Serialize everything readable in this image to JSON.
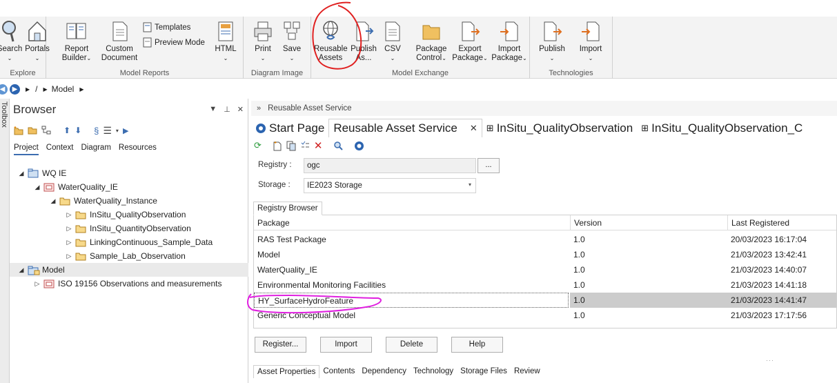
{
  "ribbon": {
    "buttons": {
      "search": "Search",
      "portals": "Portals",
      "report_builder": "Report Builder",
      "custom_document": "Custom Document",
      "templates": "Templates",
      "preview_mode": "Preview Mode",
      "html": "HTML",
      "print": "Print",
      "save": "Save",
      "reusable_assets": "Reusable Assets",
      "publish_as": "Publish As...",
      "csv": "CSV",
      "package_control": "Package Control",
      "export_package": "Export Package",
      "import_package": "Import Package",
      "publish": "Publish",
      "import": "Import"
    },
    "groups": {
      "explore": "Explore",
      "model_reports": "Model Reports",
      "diagram_image": "Diagram Image",
      "model_exchange": "Model Exchange",
      "technologies": "Technologies"
    }
  },
  "navbar": {
    "separator": "/",
    "crumb": "Model"
  },
  "browser": {
    "title": "Browser",
    "toolbox_label": "Toolbox",
    "tabs": [
      "Project",
      "Context",
      "Diagram",
      "Resources"
    ],
    "tree": [
      {
        "label": "WQ IE",
        "toggle": "◢"
      },
      {
        "label": "WaterQuality_IE",
        "toggle": "◢"
      },
      {
        "label": "WaterQuality_Instance",
        "toggle": "◢"
      },
      {
        "label": "InSitu_QualityObservation",
        "toggle": "▷"
      },
      {
        "label": "InSitu_QuantityObservation",
        "toggle": "▷"
      },
      {
        "label": "LinkingContinuous_Sample_Data",
        "toggle": "▷"
      },
      {
        "label": "Sample_Lab_Observation",
        "toggle": "▷"
      },
      {
        "label": "Model",
        "toggle": "◢"
      },
      {
        "label": "ISO 19156 Observations and measurements",
        "toggle": "▷"
      }
    ]
  },
  "main": {
    "breadcrumb": "Reusable Asset Service",
    "tabs": [
      "Start Page",
      "Reusable Asset Service",
      "InSitu_QualityObservation",
      "InSitu_QualityObservation_C"
    ],
    "registry_label": "Registry :",
    "registry_value": "ogc",
    "registry_btn": "...",
    "storage_label": "Storage :",
    "storage_value": "IE2023 Storage",
    "registry_browser_tab": "Registry Browser",
    "columns": [
      "Package",
      "Version",
      "Last Registered"
    ],
    "rows": [
      {
        "package": "RAS Test Package",
        "version": "1.0",
        "registered": "20/03/2023 16:17:04"
      },
      {
        "package": "Model",
        "version": "1.0",
        "registered": "21/03/2023 13:42:41"
      },
      {
        "package": "WaterQuality_IE",
        "version": "1.0",
        "registered": "21/03/2023 14:40:07"
      },
      {
        "package": "Environmental Monitoring Facilities",
        "version": "1.0",
        "registered": "21/03/2023 14:41:18"
      },
      {
        "package": "HY_SurfaceHydroFeature",
        "version": "1.0",
        "registered": "21/03/2023 14:41:47"
      },
      {
        "package": "Generic Conceptual Model",
        "version": "1.0",
        "registered": "21/03/2023 17:17:56"
      }
    ],
    "buttons": [
      "Register...",
      "Import",
      "Delete",
      "Help"
    ],
    "bottom_tabs": [
      "Asset Properties",
      "Contents",
      "Dependency",
      "Technology",
      "Storage Files",
      "Review"
    ]
  },
  "colors": {
    "accent": "#3c6db0",
    "annotation_red": "#e02020",
    "annotation_magenta": "#e020e0",
    "folder": "#f0c060"
  }
}
